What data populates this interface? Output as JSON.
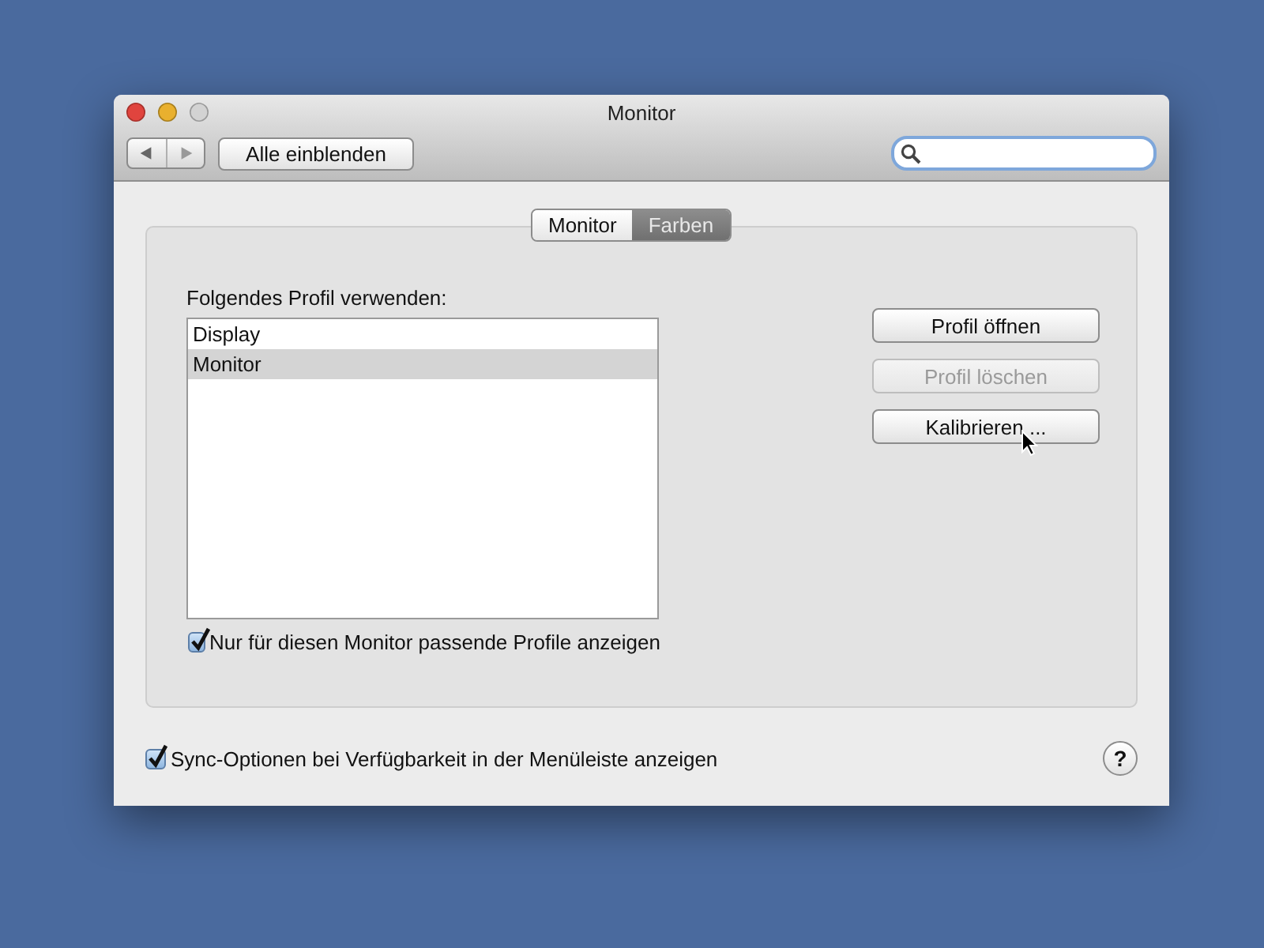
{
  "window": {
    "title": "Monitor"
  },
  "toolbar": {
    "show_all_button": "Alle einblenden"
  },
  "tabs": [
    {
      "label": "Monitor",
      "selected": false
    },
    {
      "label": "Farben",
      "selected": true
    }
  ],
  "profile_label": "Folgendes Profil verwenden:",
  "profiles": [
    {
      "label": "Display",
      "selected": false
    },
    {
      "label": "Monitor",
      "selected": true
    }
  ],
  "buttons": [
    {
      "label": "Profil öffnen",
      "disabled": false
    },
    {
      "label": "Profil löschen",
      "disabled": true
    },
    {
      "label": "Kalibrieren ...",
      "disabled": false
    }
  ],
  "filter_checkbox": {
    "label": "Nur für diesen Monitor passende Profile anzeigen",
    "checked": true
  },
  "sync_checkbox": {
    "label": "Sync-Optionen bei Verfügbarkeit in der Menüleiste anzeigen",
    "checked": true
  },
  "help_button": "?"
}
